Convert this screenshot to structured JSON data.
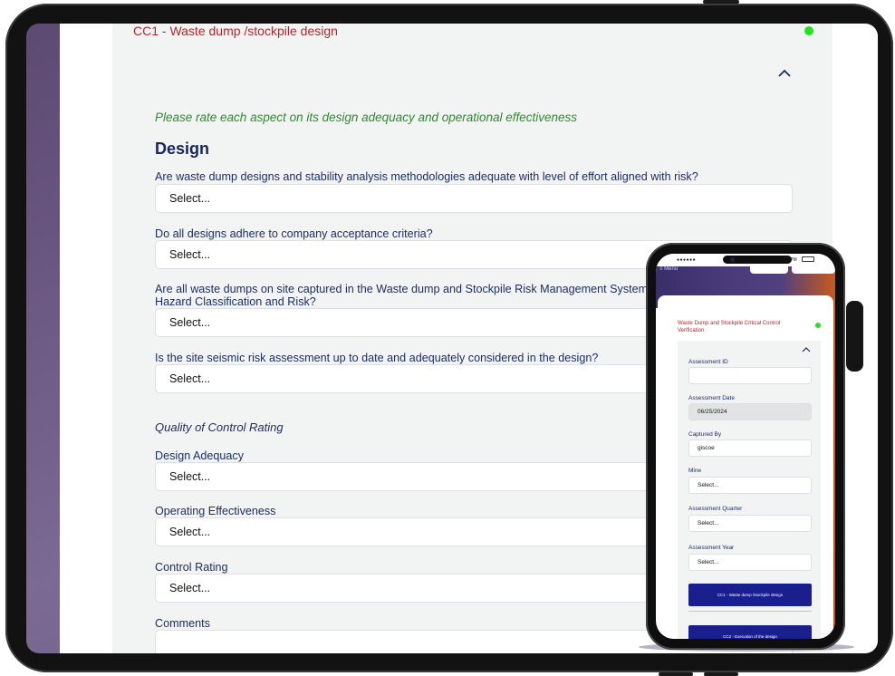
{
  "tablet_form": {
    "title": "CC1 - Waste dump /stockpile design",
    "instruction": "Please rate each aspect on its design adequacy and operational effectiveness",
    "section_heading": "Design",
    "questions": [
      {
        "label": "Are waste dump designs and stability analysis methodologies adequate with level of effort aligned with risk?",
        "value": "Select..."
      },
      {
        "label": "Do all designs adhere to company acceptance criteria?",
        "value": "Select..."
      },
      {
        "label": "Are all waste dumps on site captured in the Waste dump and Stockpile Risk Management System, a",
        "label2": "Hazard Classification and Risk?",
        "value": "Select..."
      },
      {
        "label": "Is the site seismic risk assessment up to date and adequately considered in the design?",
        "value": "Select..."
      }
    ],
    "quality_heading": "Quality of Control Rating",
    "ratings": [
      {
        "label": "Design Adequacy",
        "value": "Select..."
      },
      {
        "label": "Operating Effectiveness",
        "value": "Select..."
      },
      {
        "label": "Control Rating",
        "value": "Select..."
      },
      {
        "label": "Comments",
        "value": ""
      }
    ],
    "status_color": "#22e41b",
    "title_color": "#b4262c"
  },
  "phone_form": {
    "status_bar": {
      "signal": "●●●●●●",
      "time": "1:30 PM"
    },
    "menu_label": "≡ Menu",
    "title": "Waste Dump and Stockpile Critical Control Verification",
    "fields": [
      {
        "label": "Assessment ID",
        "value": ""
      },
      {
        "label": "Assessment Date",
        "value": "06/25/2024"
      },
      {
        "label": "Captured By",
        "value": "giscoe"
      },
      {
        "label": "Mine",
        "value": "Select..."
      },
      {
        "label": "Assessment Quarter",
        "value": "Select..."
      },
      {
        "label": "Assessment Year",
        "value": "Select..."
      }
    ],
    "buttons": [
      {
        "label": "CC1 - Waste dump /stockpile design"
      },
      {
        "label": "CC2 - Execution of the design"
      }
    ],
    "button_color": "#1a1f8e"
  }
}
